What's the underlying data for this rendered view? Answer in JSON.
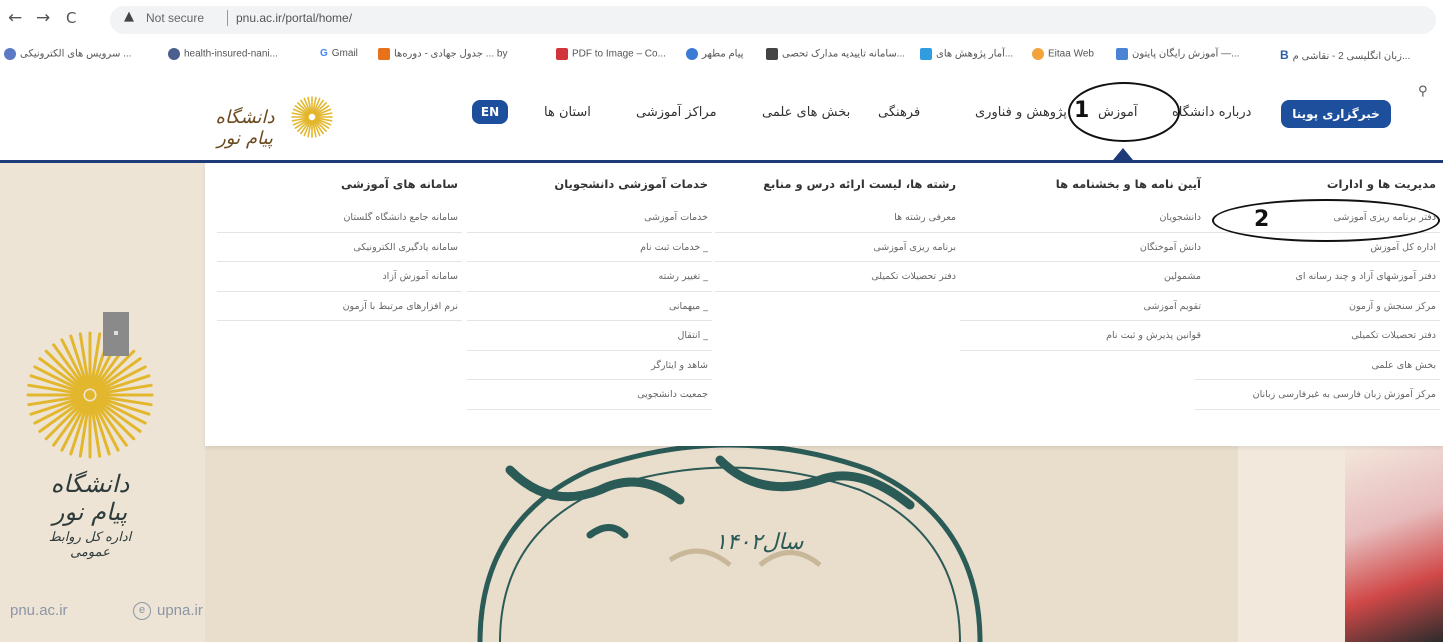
{
  "browser": {
    "back_icon": "←",
    "forward_icon": "→",
    "reload_icon": "C",
    "warning_icon": "▲",
    "not_secure": "Not secure",
    "url": "pnu.ac.ir/portal/home/",
    "bookmarks": [
      {
        "label": "سرویس های الکترونیکی ...",
        "color": "#5b79c4"
      },
      {
        "label": "health-insured-nani...",
        "color": "#4a5f8d"
      },
      {
        "label": "Gmail",
        "color": "#db4437"
      },
      {
        "label": "جدول جهادی - دوره‌ها ... by",
        "color": "#e8711a"
      },
      {
        "label": "PDF to Image – Co...",
        "color": "#d1343a"
      },
      {
        "label": "پیام مطهر",
        "color": "#3a7bd5"
      },
      {
        "label": "سامانه تاییدیه مدارک تحصی...",
        "color": "#444444"
      },
      {
        "label": "آمار پژوهش های...",
        "color": "#2f9de0"
      },
      {
        "label": "Eitaa Web",
        "color": "#f2a33a"
      },
      {
        "label": "آموزش رایگان پایتون —...",
        "color": "#4a83d4"
      },
      {
        "label": "زبان انگلیسی 2 - نقاشی م...",
        "color": "#2a5ea8"
      }
    ]
  },
  "header": {
    "logo_text": "دانشگاه پیام نور",
    "news_button": "خبرگزاری پوینا",
    "nav": [
      "درباره دانشگاه",
      "آموزش",
      "پژوهش و فناوری",
      "فرهنگی",
      "بخش های علمی",
      "مراکز آموزشی",
      "استان ها"
    ],
    "lang_button": "EN",
    "search_icon": "⚲",
    "annotation_1": "1"
  },
  "mega_menu": {
    "annotation_2": "2",
    "columns": [
      {
        "title": "مدیریت ها و ادارات",
        "items": [
          "دفتر برنامه ریزی آموزشی",
          "اداره کل آموزش",
          "دفتر آموزشهای آزاد و چند رسانه ای",
          "مرکز سنجش و آزمون",
          "دفتر تحصیلات تکمیلی",
          "بخش های علمی",
          "مرکز آموزش زبان فارسی به غیرفارسی زبانان"
        ]
      },
      {
        "title": "آیین نامه ها و بخشنامه ها",
        "items": [
          "دانشجویان",
          "دانش آموختگان",
          "مشمولین",
          "تقویم آموزشی",
          "قوانین پذیرش و ثبت نام"
        ]
      },
      {
        "title": "رشته ها، لیست ارائه درس و منابع",
        "items": [
          "معرفی رشته ها",
          "برنامه ریزی آموزشی",
          "دفتر تحصیلات تکمیلی"
        ]
      },
      {
        "title": "خدمات آموزشی دانشجویان",
        "items": [
          "خدمات آموزشی",
          "_ خدمات ثبت نام",
          "_ تغییر رشته",
          "_ میهمانی",
          "_ انتقال",
          "شاهد و ایثارگر",
          "جمعیت دانشجویی"
        ]
      },
      {
        "title": "سامانه های آموزشی",
        "items": [
          "سامانه جامع دانشگاه گلستان",
          "سامانه یادگیری الکترونیکی",
          "سامانه آموزش آزاد",
          "نرم افزارهای مرتبط با آزمون"
        ]
      }
    ]
  },
  "banner": {
    "big_logo_line1": "دانشگاه پیام نور",
    "big_logo_line2": "اداره کل روابط عمومی",
    "year_text": "سال۱۴۰۲",
    "footer_left": "pnu.ac.ir",
    "footer_right": "upna.ir",
    "footer_at_icon": "e"
  }
}
